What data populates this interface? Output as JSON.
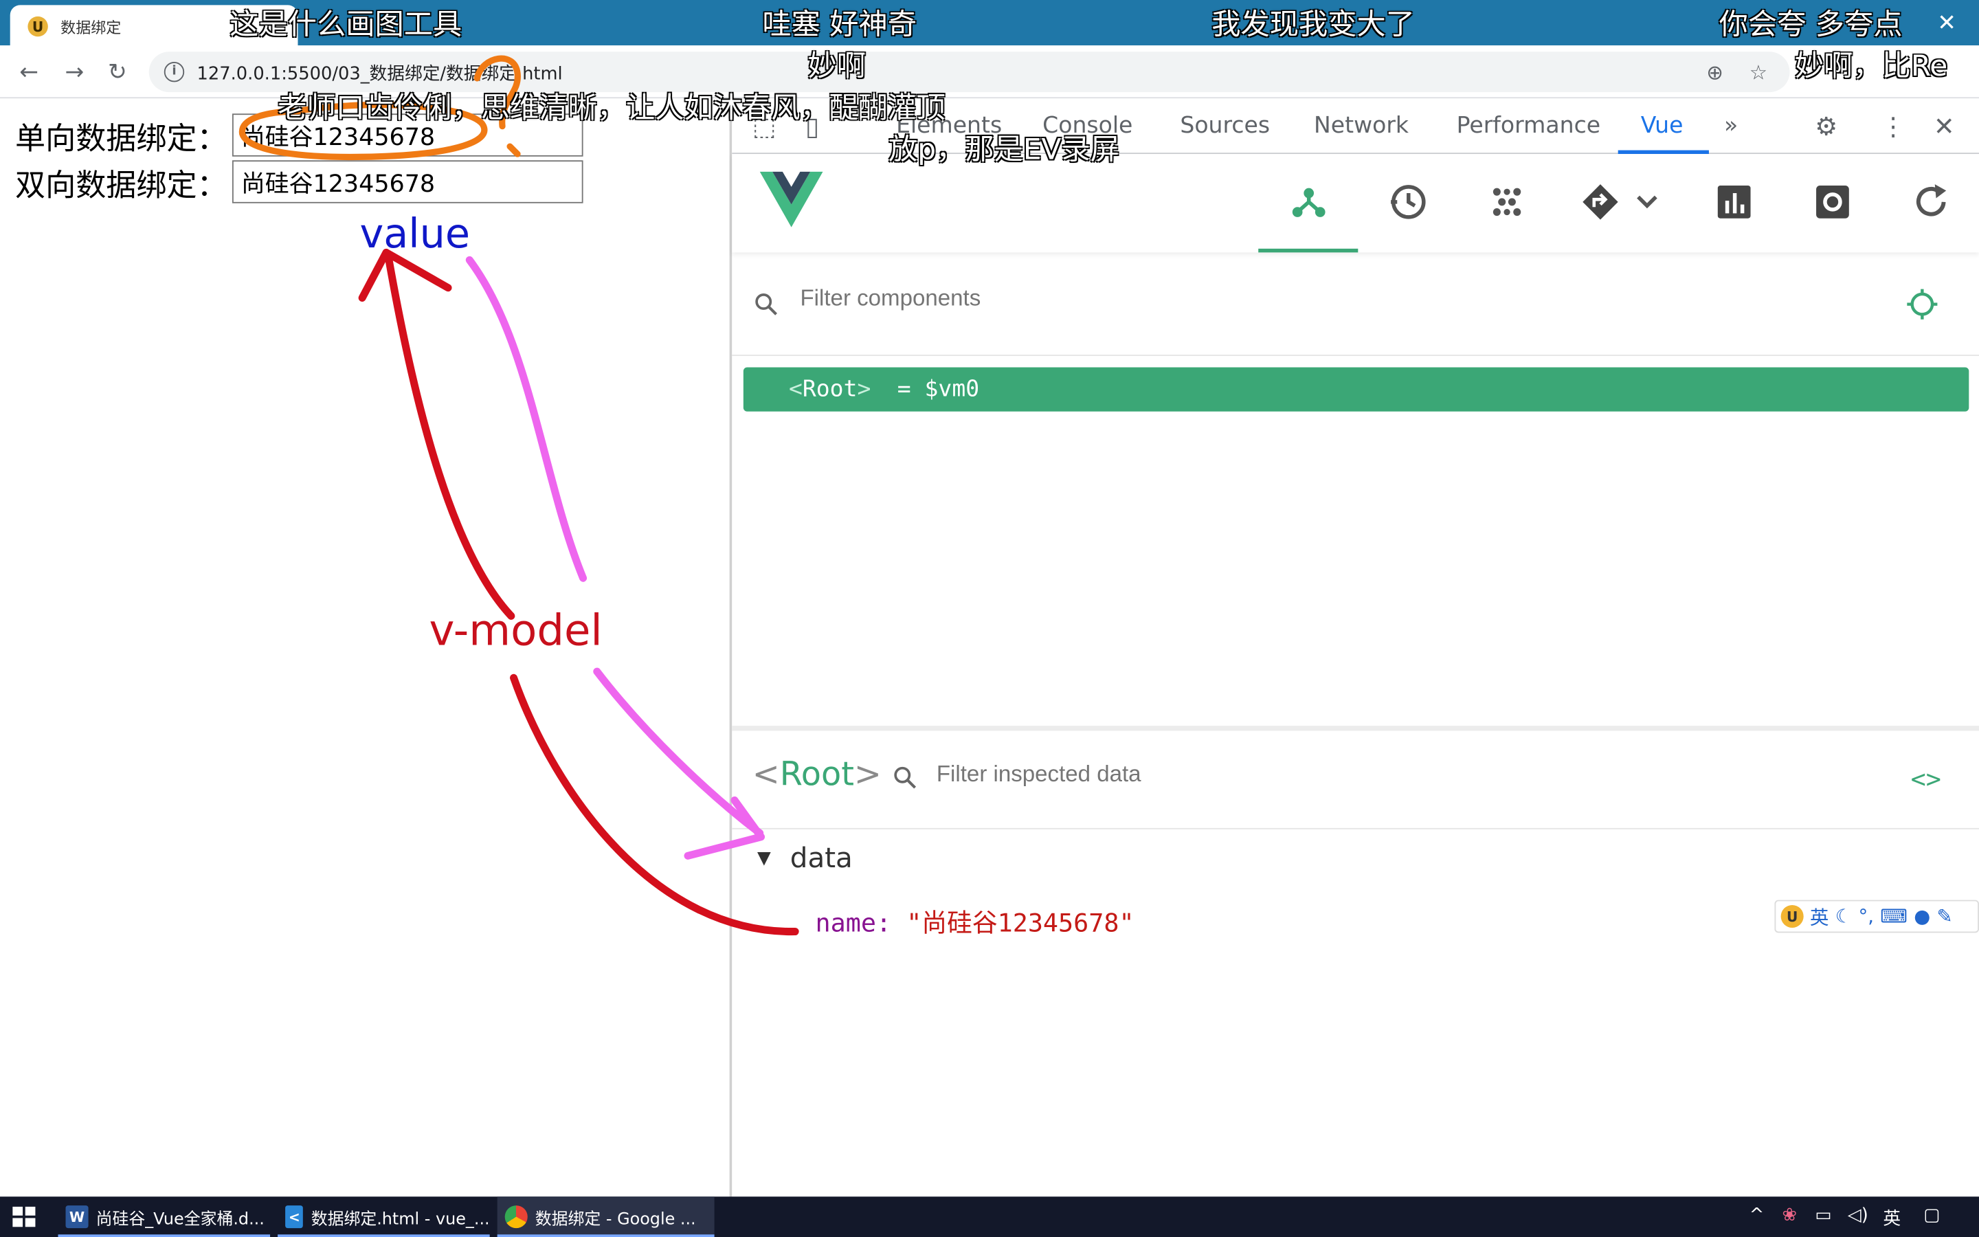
{
  "browser": {
    "tab_title": "数据绑定",
    "favicon_glyph": "U",
    "url": "127.0.0.1:5500/03_数据绑定/数据绑定.html",
    "url_hidden_part": "数据绑定.html"
  },
  "page": {
    "one_way_label": "单向数据绑定：",
    "one_way_value": "尚硅谷12345678",
    "two_way_label": "双向数据绑定：",
    "two_way_value": "尚硅谷12345678"
  },
  "devtools": {
    "tabs": [
      "Elements",
      "Console",
      "Sources",
      "Network",
      "Performance",
      "Vue"
    ],
    "active_tab": "Vue",
    "more_tabs_glyph": "»",
    "vue": {
      "filter_components_placeholder": "Filter components",
      "root_node": "Root",
      "root_assign": "= $vm0",
      "inspector_title": "Root",
      "filter_data_placeholder": "Filter inspected data",
      "code_toggle": "<>",
      "data_section": "data",
      "data_key": "name",
      "data_value": "\"尚硅谷12345678\""
    }
  },
  "ime": {
    "lang": "英"
  },
  "annotations": {
    "value_label": "value",
    "vmodel_label": "v-model",
    "question_mark": "?",
    "colors": {
      "value": "#0f18c8",
      "vmodel": "#c8101c",
      "pink": "#ee66ee",
      "orange": "#f07a14"
    }
  },
  "danmaku": [
    "这是什么画图工具",
    "哇塞  好神奇",
    "我发现我变大了",
    "你会夸 多夸点",
    "妙啊",
    "妙啊，比Re",
    "老师口齿伶俐，思维清晰，让人如沐春风，醍醐灌顶",
    "放p，那是EV录屏"
  ],
  "taskbar": {
    "items": [
      {
        "label": "尚硅谷_Vue全家桶.d...",
        "icon": "W",
        "color": "#2b579a"
      },
      {
        "label": "数据绑定.html - vue_...",
        "icon": "<",
        "color": "#2a87d8"
      },
      {
        "label": "数据绑定 - Google ...",
        "icon": "",
        "color": "#ea4335"
      }
    ],
    "tray_lang": "英"
  }
}
